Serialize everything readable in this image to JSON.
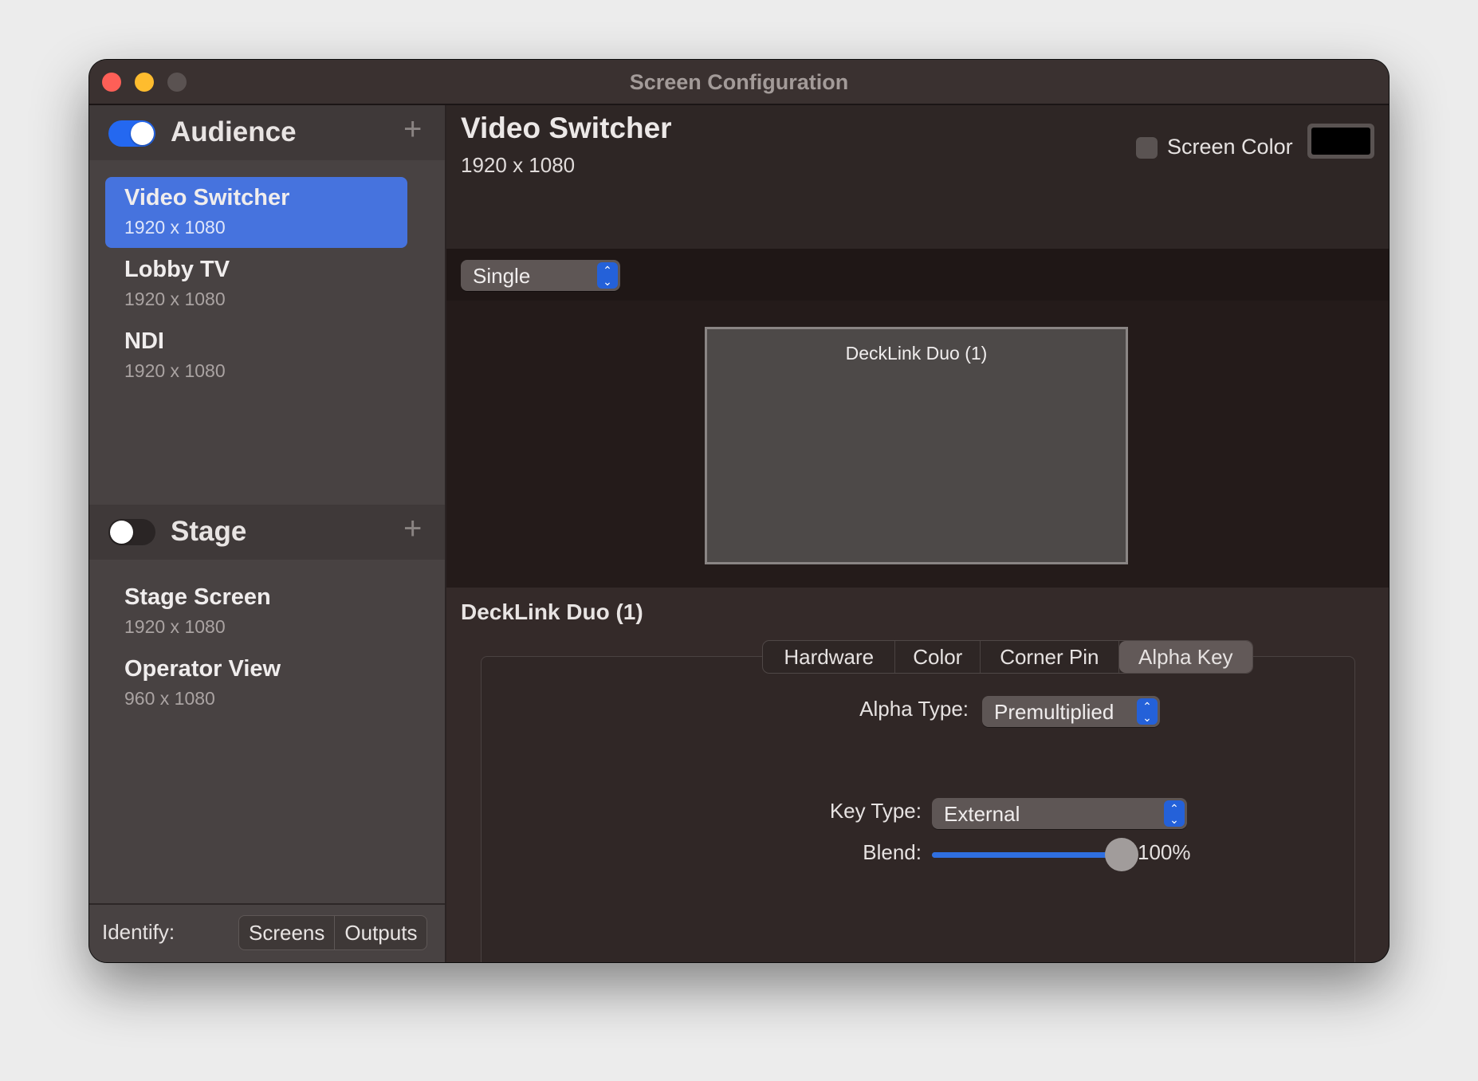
{
  "window": {
    "title": "Screen Configuration"
  },
  "sidebar": {
    "groups": [
      {
        "name": "Audience",
        "enabled": true,
        "items": [
          {
            "title": "Video Switcher",
            "resolution": "1920 x 1080",
            "selected": true
          },
          {
            "title": "Lobby TV",
            "resolution": "1920 x 1080"
          },
          {
            "title": "NDI",
            "resolution": "1920 x 1080"
          }
        ]
      },
      {
        "name": "Stage",
        "enabled": false,
        "items": [
          {
            "title": "Stage Screen",
            "resolution": "1920 x 1080"
          },
          {
            "title": "Operator View",
            "resolution": "960 x 1080"
          }
        ]
      }
    ],
    "add_icon": "plus-icon",
    "footer": {
      "label": "Identify:",
      "buttons": [
        "Screens",
        "Outputs"
      ]
    }
  },
  "main": {
    "title": "Video Switcher",
    "resolution": "1920 x 1080",
    "screen_color": {
      "label": "Screen Color",
      "checked": false,
      "color": "#000000"
    },
    "layout_select": "Single",
    "preview": {
      "output_label": "DeckLink Duo (1)"
    },
    "output": {
      "title": "DeckLink Duo (1)",
      "tabs": [
        "Hardware",
        "Color",
        "Corner Pin",
        "Alpha Key"
      ],
      "active_tab": "Alpha Key",
      "alpha_type": {
        "label": "Alpha Type:",
        "value": "Premultiplied"
      },
      "key_type": {
        "label": "Key Type:",
        "value": "External"
      },
      "blend": {
        "label": "Blend:",
        "value": 100,
        "display": "100%"
      },
      "help": "?"
    }
  },
  "colors": {
    "accent": "#4673de",
    "popup_arrow": "#2461d9",
    "close": "#ff5f57",
    "minimize": "#febc2e"
  }
}
